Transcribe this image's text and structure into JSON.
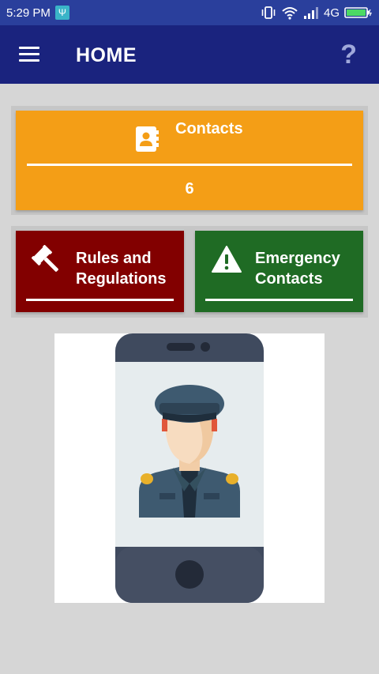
{
  "status_bar": {
    "time": "5:29 PM",
    "network": "4G",
    "usb_icon": "usb-icon",
    "icons": [
      "vibrate-icon",
      "wifi-icon",
      "signal-icon",
      "battery-icon"
    ]
  },
  "app_bar": {
    "title": "HOME",
    "menu_icon": "menu-icon",
    "help_label": "?"
  },
  "contacts": {
    "title": "Contacts",
    "count": "6",
    "icon": "contact-book-icon",
    "color": "#f49e16"
  },
  "tiles": [
    {
      "label": "Rules and Regulations",
      "icon": "gavel-icon",
      "color": "#820000"
    },
    {
      "label": "Emergency Contacts",
      "icon": "warning-icon",
      "color": "#1f6b24"
    }
  ],
  "colors": {
    "status_bar": "#2a3f9c",
    "app_bar": "#1a237e",
    "background": "#d6d6d6"
  },
  "illustration": {
    "icon": "police-officer-on-phone-illustration"
  }
}
